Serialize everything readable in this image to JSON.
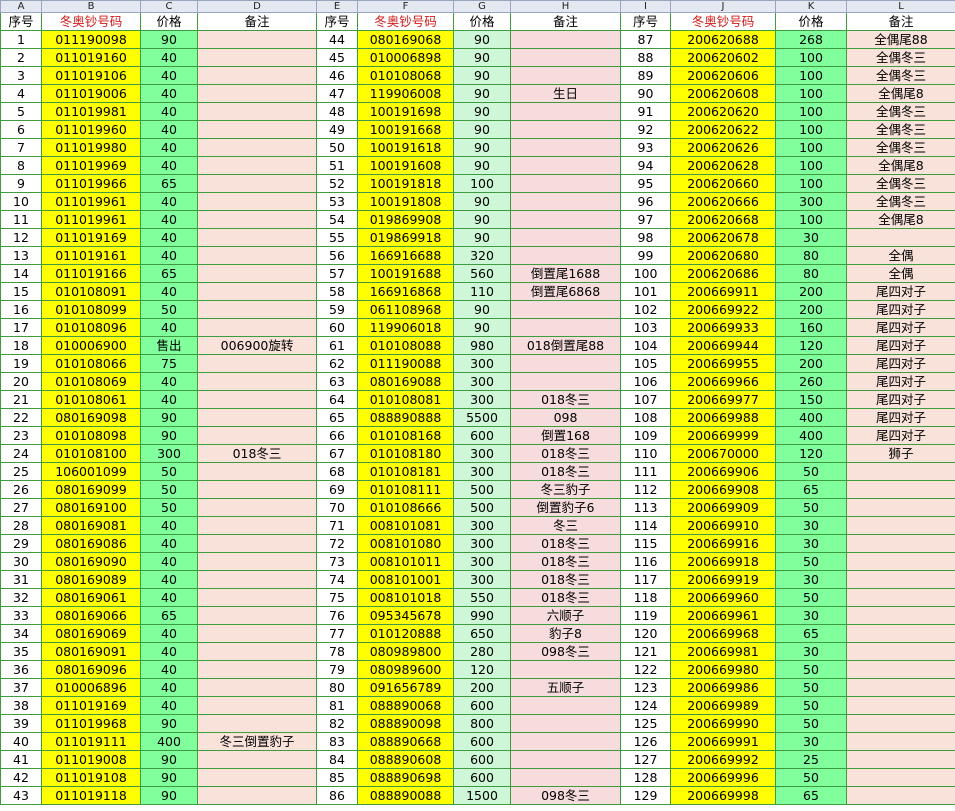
{
  "columns": [
    "A",
    "B",
    "C",
    "D",
    "E",
    "F",
    "G",
    "H",
    "I",
    "J",
    "K",
    "L"
  ],
  "header": [
    "序号",
    "冬奥钞号码",
    "价格",
    "备注",
    "序号",
    "冬奥钞号码",
    "价格",
    "备注",
    "序号",
    "冬奥钞号码",
    "价格",
    "备注"
  ],
  "rows": [
    [
      "1",
      "011190098",
      "90",
      "",
      "44",
      "080169068",
      "90",
      "",
      "87",
      "200620688",
      "268",
      "全偶尾88"
    ],
    [
      "2",
      "011019160",
      "40",
      "",
      "45",
      "010006898",
      "90",
      "",
      "88",
      "200620602",
      "100",
      "全偶冬三"
    ],
    [
      "3",
      "011019106",
      "40",
      "",
      "46",
      "010108068",
      "90",
      "",
      "89",
      "200620606",
      "100",
      "全偶冬三"
    ],
    [
      "4",
      "011019006",
      "40",
      "",
      "47",
      "119906008",
      "90",
      "生日",
      "90",
      "200620608",
      "100",
      "全偶尾8"
    ],
    [
      "5",
      "011019981",
      "40",
      "",
      "48",
      "100191698",
      "90",
      "",
      "91",
      "200620620",
      "100",
      "全偶冬三"
    ],
    [
      "6",
      "011019960",
      "40",
      "",
      "49",
      "100191668",
      "90",
      "",
      "92",
      "200620622",
      "100",
      "全偶冬三"
    ],
    [
      "7",
      "011019980",
      "40",
      "",
      "50",
      "100191618",
      "90",
      "",
      "93",
      "200620626",
      "100",
      "全偶冬三"
    ],
    [
      "8",
      "011019969",
      "40",
      "",
      "51",
      "100191608",
      "90",
      "",
      "94",
      "200620628",
      "100",
      "全偶尾8"
    ],
    [
      "9",
      "011019966",
      "65",
      "",
      "52",
      "100191818",
      "100",
      "",
      "95",
      "200620660",
      "100",
      "全偶冬三"
    ],
    [
      "10",
      "011019961",
      "40",
      "",
      "53",
      "100191808",
      "90",
      "",
      "96",
      "200620666",
      "300",
      "全偶冬三"
    ],
    [
      "11",
      "011019961",
      "40",
      "",
      "54",
      "019869908",
      "90",
      "",
      "97",
      "200620668",
      "100",
      "全偶尾8"
    ],
    [
      "12",
      "011019169",
      "40",
      "",
      "55",
      "019869918",
      "90",
      "",
      "98",
      "200620678",
      "30",
      ""
    ],
    [
      "13",
      "011019161",
      "40",
      "",
      "56",
      "166916688",
      "320",
      "",
      "99",
      "200620680",
      "80",
      "全偶"
    ],
    [
      "14",
      "011019166",
      "65",
      "",
      "57",
      "100191688",
      "560",
      "倒置尾1688",
      "100",
      "200620686",
      "80",
      "全偶"
    ],
    [
      "15",
      "010108091",
      "40",
      "",
      "58",
      "166916868",
      "110",
      "倒置尾6868",
      "101",
      "200669911",
      "200",
      "尾四对子"
    ],
    [
      "16",
      "010108099",
      "50",
      "",
      "59",
      "061108968",
      "90",
      "",
      "102",
      "200669922",
      "200",
      "尾四对子"
    ],
    [
      "17",
      "010108096",
      "40",
      "",
      "60",
      "119906018",
      "90",
      "",
      "103",
      "200669933",
      "160",
      "尾四对子"
    ],
    [
      "18",
      "010006900",
      "售出",
      "006900旋转",
      "61",
      "010108088",
      "980",
      "018倒置尾88",
      "104",
      "200669944",
      "120",
      "尾四对子"
    ],
    [
      "19",
      "010108066",
      "75",
      "",
      "62",
      "011190088",
      "300",
      "",
      "105",
      "200669955",
      "200",
      "尾四对子"
    ],
    [
      "20",
      "010108069",
      "40",
      "",
      "63",
      "080169088",
      "300",
      "",
      "106",
      "200669966",
      "260",
      "尾四对子"
    ],
    [
      "21",
      "010108061",
      "40",
      "",
      "64",
      "010108081",
      "300",
      "018冬三",
      "107",
      "200669977",
      "150",
      "尾四对子"
    ],
    [
      "22",
      "080169098",
      "90",
      "",
      "65",
      "088890888",
      "5500",
      "098",
      "108",
      "200669988",
      "400",
      "尾四对子"
    ],
    [
      "23",
      "010108098",
      "90",
      "",
      "66",
      "010108168",
      "600",
      "倒置168",
      "109",
      "200669999",
      "400",
      "尾四对子"
    ],
    [
      "24",
      "010108100",
      "300",
      "018冬三",
      "67",
      "010108180",
      "300",
      "018冬三",
      "110",
      "200670000",
      "120",
      "狮子"
    ],
    [
      "25",
      "106001099",
      "50",
      "",
      "68",
      "010108181",
      "300",
      "018冬三",
      "111",
      "200669906",
      "50",
      ""
    ],
    [
      "26",
      "080169099",
      "50",
      "",
      "69",
      "010108111",
      "500",
      "冬三豹子",
      "112",
      "200669908",
      "65",
      ""
    ],
    [
      "27",
      "080169100",
      "50",
      "",
      "70",
      "010108666",
      "500",
      "倒置豹子6",
      "113",
      "200669909",
      "50",
      ""
    ],
    [
      "28",
      "080169081",
      "40",
      "",
      "71",
      "008101081",
      "300",
      "冬三",
      "114",
      "200669910",
      "30",
      ""
    ],
    [
      "29",
      "080169086",
      "40",
      "",
      "72",
      "008101080",
      "300",
      "018冬三",
      "115",
      "200669916",
      "30",
      ""
    ],
    [
      "30",
      "080169090",
      "40",
      "",
      "73",
      "008101011",
      "300",
      "018冬三",
      "116",
      "200669918",
      "50",
      ""
    ],
    [
      "31",
      "080169089",
      "40",
      "",
      "74",
      "008101001",
      "300",
      "018冬三",
      "117",
      "200669919",
      "30",
      ""
    ],
    [
      "32",
      "080169061",
      "40",
      "",
      "75",
      "008101018",
      "550",
      "018冬三",
      "118",
      "200669960",
      "50",
      ""
    ],
    [
      "33",
      "080169066",
      "65",
      "",
      "76",
      "095345678",
      "990",
      "六顺子",
      "119",
      "200669961",
      "30",
      ""
    ],
    [
      "34",
      "080169069",
      "40",
      "",
      "77",
      "010120888",
      "650",
      "豹子8",
      "120",
      "200669968",
      "65",
      ""
    ],
    [
      "35",
      "080169091",
      "40",
      "",
      "78",
      "080989800",
      "280",
      "098冬三",
      "121",
      "200669981",
      "30",
      ""
    ],
    [
      "36",
      "080169096",
      "40",
      "",
      "79",
      "080989600",
      "120",
      "",
      "122",
      "200669980",
      "50",
      ""
    ],
    [
      "37",
      "010006896",
      "40",
      "",
      "80",
      "091656789",
      "200",
      "五顺子",
      "123",
      "200669986",
      "50",
      ""
    ],
    [
      "38",
      "011019169",
      "40",
      "",
      "81",
      "088890068",
      "600",
      "",
      "124",
      "200669989",
      "50",
      ""
    ],
    [
      "39",
      "011019968",
      "90",
      "",
      "82",
      "088890098",
      "800",
      "",
      "125",
      "200669990",
      "50",
      ""
    ],
    [
      "40",
      "011019111",
      "400",
      "冬三倒置豹子",
      "83",
      "088890668",
      "600",
      "",
      "126",
      "200669991",
      "30",
      ""
    ],
    [
      "41",
      "011019008",
      "90",
      "",
      "84",
      "088890608",
      "600",
      "",
      "127",
      "200669992",
      "25",
      ""
    ],
    [
      "42",
      "011019108",
      "90",
      "",
      "85",
      "088890698",
      "600",
      "",
      "128",
      "200669996",
      "50",
      ""
    ],
    [
      "43",
      "011019118",
      "90",
      "",
      "86",
      "088890088",
      "1500",
      "098冬三",
      "129",
      "200669998",
      "65",
      ""
    ]
  ],
  "colors": {
    "grid": "#3d9c3d",
    "number_fill": "#ffff00",
    "price_fill": "#80ff9c",
    "note_fill": "#f9e2da",
    "header_red_text": "#d11a1a"
  }
}
